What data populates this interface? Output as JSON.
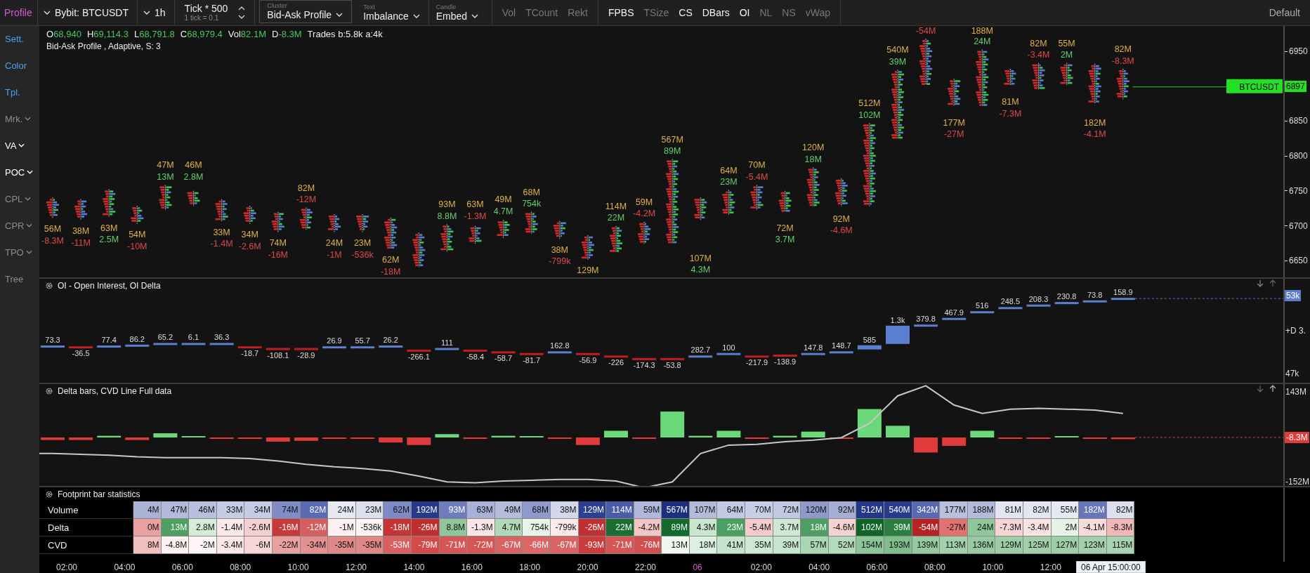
{
  "toolbar": {
    "profile": "Profile",
    "symbol": "Bybit: BTCUSDT",
    "timeframe": "1h",
    "tick": {
      "value": "Tick * 500",
      "hint": "1 tick = 0.1"
    },
    "selectors": [
      {
        "caption": "Cluster",
        "value": "Bid-Ask Profile",
        "selected": true
      },
      {
        "caption": "Text",
        "value": "Imbalance",
        "selected": false
      },
      {
        "caption": "Candle",
        "value": "Embed",
        "selected": false
      }
    ],
    "toggle_groups": [
      [
        {
          "label": "Vol",
          "on": false
        },
        {
          "label": "TCount",
          "on": false
        },
        {
          "label": "Rekt",
          "on": false
        }
      ],
      [
        {
          "label": "FPBS",
          "on": true
        },
        {
          "label": "TSize",
          "on": false
        },
        {
          "label": "CS",
          "on": true
        },
        {
          "label": "DBars",
          "on": true
        },
        {
          "label": "OI",
          "on": true
        },
        {
          "label": "NL",
          "on": false
        },
        {
          "label": "NS",
          "on": false
        },
        {
          "label": "vWap",
          "on": false
        }
      ]
    ],
    "layout": "Default"
  },
  "sidebar": [
    {
      "label": "Sett.",
      "kind": "link"
    },
    {
      "label": "Color",
      "kind": "link"
    },
    {
      "label": "Tpl.",
      "kind": "link"
    },
    {
      "label": "Mrk.",
      "kind": "menu",
      "enabled": false
    },
    {
      "label": "VA",
      "kind": "menu",
      "enabled": true
    },
    {
      "label": "POC",
      "kind": "menu",
      "enabled": true
    },
    {
      "label": "CPL",
      "kind": "menu",
      "enabled": false
    },
    {
      "label": "CPR",
      "kind": "menu",
      "enabled": false
    },
    {
      "label": "TPO",
      "kind": "menu",
      "enabled": false
    },
    {
      "label": "Tree",
      "kind": "item",
      "enabled": false
    }
  ],
  "main_chart": {
    "readouts": [
      {
        "label": "O",
        "value": "68,940"
      },
      {
        "label": "H",
        "value": "69,114.3"
      },
      {
        "label": "L",
        "value": "68,791.8"
      },
      {
        "label": "C",
        "value": "68,979.4"
      },
      {
        "label": "Vol",
        "value": "82.1M"
      },
      {
        "label": "D",
        "value": "-8.3M"
      }
    ],
    "trades": "Trades b:5.8k a:4k",
    "indicator": "Bid-Ask Profile , Adaptive, S: 3",
    "price_tag": "BTCUSDT",
    "price_axis": {
      "ticks": [
        "6950",
        "6850",
        "6800",
        "6750",
        "6700",
        "6650"
      ],
      "current": "6897"
    },
    "bars": [
      {
        "volume": "56M",
        "delta": "-8.3M",
        "delta_positive": false
      },
      {
        "volume": "38M",
        "delta": "-11M",
        "delta_positive": false
      },
      {
        "volume": "63M",
        "delta": "2.5M",
        "delta_positive": true
      },
      {
        "volume": "54M",
        "delta": "-10M",
        "delta_positive": false
      },
      {
        "volume": "47M",
        "delta": "13M",
        "delta_positive": true
      },
      {
        "volume": "46M",
        "delta": "2.8M",
        "delta_positive": true
      },
      {
        "volume": "33M",
        "delta": "-1.4M",
        "delta_positive": false
      },
      {
        "volume": "34M",
        "delta": "-2.6M",
        "delta_positive": false
      },
      {
        "volume": "74M",
        "delta": "-16M",
        "delta_positive": false
      },
      {
        "volume": "82M",
        "delta": "-12M",
        "delta_positive": false
      },
      {
        "volume": "24M",
        "delta": "-1M",
        "delta_positive": false
      },
      {
        "volume": "23M",
        "delta": "-536k",
        "delta_positive": false
      },
      {
        "volume": "62M",
        "delta": "-18M",
        "delta_positive": false
      },
      {
        "delta_positive": false
      },
      {
        "volume": "93M",
        "delta": "8.8M",
        "delta_positive": true
      },
      {
        "volume": "63M",
        "delta": "-1.3M",
        "delta_positive": false
      },
      {
        "volume": "49M",
        "delta": "4.7M",
        "delta_positive": true
      },
      {
        "volume": "68M",
        "delta": "754k",
        "delta_positive": true
      },
      {
        "volume": "38M",
        "delta": "-799k",
        "delta_positive": false
      },
      {
        "volume": "129M",
        "delta_positive": false
      },
      {
        "volume": "114M",
        "delta": "22M",
        "delta_positive": true
      },
      {
        "volume": "59M",
        "delta": "-4.2M",
        "delta_positive": false
      },
      {
        "volume": "567M",
        "delta": "89M",
        "delta_positive": true
      },
      {
        "volume": "107M",
        "delta": "4.3M",
        "delta_positive": true
      },
      {
        "volume": "64M",
        "delta": "23M",
        "delta_positive": true
      },
      {
        "volume": "70M",
        "delta": "-5.4M",
        "delta_positive": false
      },
      {
        "volume": "72M",
        "delta": "3.7M",
        "delta_positive": true
      },
      {
        "volume": "120M",
        "delta": "18M",
        "delta_positive": true
      },
      {
        "volume": "92M",
        "delta": "-4.6M",
        "delta_positive": false
      },
      {
        "volume": "512M",
        "delta": "102M",
        "delta_positive": true
      },
      {
        "volume": "540M",
        "delta": "39M",
        "delta_positive": true
      },
      {
        "delta": "-54M",
        "delta_positive": false
      },
      {
        "volume": "177M",
        "delta": "-27M",
        "delta_positive": false
      },
      {
        "volume": "188M",
        "delta": "24M",
        "delta_positive": true
      },
      {
        "volume": "81M",
        "delta": "-7.3M",
        "delta_positive": false
      },
      {
        "volume": "82M",
        "delta": "-3.4M",
        "delta_positive": false
      },
      {
        "volume": "55M",
        "delta": "2M",
        "delta_positive": true
      },
      {
        "volume": "182M",
        "delta": "-4.1M",
        "delta_positive": false
      },
      {
        "volume": "82M",
        "delta": "-8.3M",
        "delta_positive": false
      }
    ]
  },
  "oi": {
    "title": "OI - Open Interest, OI Delta",
    "axis": {
      "current": "53k",
      "middle": "+D 3.",
      "bottom": "47k"
    },
    "items": [
      {
        "value": "73.3",
        "positive": true
      },
      {
        "value": "-36.5",
        "positive": false
      },
      {
        "value": "77.4",
        "positive": true
      },
      {
        "value": "86.2",
        "positive": true
      },
      {
        "value": "65.2",
        "positive": true
      },
      {
        "value": "6.1",
        "positive": true
      },
      {
        "value": "36.3",
        "positive": true
      },
      {
        "value": "-18.7",
        "positive": false
      },
      {
        "value": "-108.1",
        "positive": false
      },
      {
        "value": "-28.9",
        "positive": false
      },
      {
        "value": "26.9",
        "positive": true
      },
      {
        "value": "55.7",
        "positive": true
      },
      {
        "value": "26.2",
        "positive": true
      },
      {
        "value": "-266.1",
        "positive": false
      },
      {
        "value": "111",
        "positive": true
      },
      {
        "value": "-58.4",
        "positive": false
      },
      {
        "value": "-58.7",
        "positive": false
      },
      {
        "value": "-81.7",
        "positive": false
      },
      {
        "value": "162.8",
        "positive": true
      },
      {
        "value": "-56.9",
        "positive": false
      },
      {
        "value": "-226",
        "positive": false
      },
      {
        "value": "-174.3",
        "positive": false
      },
      {
        "value": "-53.8",
        "positive": false
      },
      {
        "value": "282.7",
        "positive": true
      },
      {
        "value": "100",
        "positive": true
      },
      {
        "value": "-217.9",
        "positive": false
      },
      {
        "value": "-138.9",
        "positive": false
      },
      {
        "value": "147.8",
        "positive": true
      },
      {
        "value": "148.7",
        "positive": true
      },
      {
        "value": "585",
        "positive": true
      },
      {
        "value": "1.3k",
        "positive": true
      },
      {
        "value": "379.8",
        "positive": true
      },
      {
        "value": "467.9",
        "positive": true
      },
      {
        "value": "516",
        "positive": true
      },
      {
        "value": "248.5",
        "positive": true
      },
      {
        "value": "208.3",
        "positive": true
      },
      {
        "value": "230.8",
        "positive": true
      },
      {
        "value": "73.8",
        "positive": true
      },
      {
        "value": "158.9",
        "positive": true
      }
    ]
  },
  "delta_panel": {
    "title": "Delta bars, CVD Line Full data",
    "axis": {
      "top": "143M",
      "current": "-8.3M",
      "bottom": "-152M"
    }
  },
  "stats": {
    "title": "Footprint bar statistics",
    "rows": [
      {
        "label": "Volume",
        "cells": [
          {
            "text": "4M",
            "color": "#aab3d6"
          },
          {
            "text": "47M",
            "color": "#b3bbdc"
          },
          {
            "text": "46M",
            "color": "#b8c0de"
          },
          {
            "text": "33M",
            "color": "#c6cce4"
          },
          {
            "text": "34M",
            "color": "#c6cce4"
          },
          {
            "text": "74M",
            "color": "#7f8cc5"
          },
          {
            "text": "82M",
            "color": "#5a6ab3"
          },
          {
            "text": "24M",
            "color": "#e6e8f2"
          },
          {
            "text": "23M",
            "color": "#dcdfee"
          },
          {
            "text": "62M",
            "color": "#7d8ac4"
          },
          {
            "text": "192M",
            "color": "#273a8a"
          },
          {
            "text": "93M",
            "color": "#6f7dbc"
          },
          {
            "text": "63M",
            "color": "#a8b1d6"
          },
          {
            "text": "49M",
            "color": "#b4bcdb"
          },
          {
            "text": "68M",
            "color": "#8e9acb"
          },
          {
            "text": "38M",
            "color": "#d3d7ea"
          },
          {
            "text": "129M",
            "color": "#2d3f8f"
          },
          {
            "text": "114M",
            "color": "#4b5ca9"
          },
          {
            "text": "59M",
            "color": "#b0b8da"
          },
          {
            "text": "567M",
            "color": "#1d2f7e"
          },
          {
            "text": "107M",
            "color": "#b3bbdb"
          },
          {
            "text": "64M",
            "color": "#c2c9e2"
          },
          {
            "text": "70M",
            "color": "#c8cee5"
          },
          {
            "text": "72M",
            "color": "#c1c8e2"
          },
          {
            "text": "120M",
            "color": "#8f9acb"
          },
          {
            "text": "92M",
            "color": "#a4aed4"
          },
          {
            "text": "512M",
            "color": "#25378a"
          },
          {
            "text": "540M",
            "color": "#283a8b"
          },
          {
            "text": "342M",
            "color": "#5868b2"
          },
          {
            "text": "177M",
            "color": "#b8c0de"
          },
          {
            "text": "188M",
            "color": "#b3bbdb"
          },
          {
            "text": "81M",
            "color": "#e3e6f1"
          },
          {
            "text": "82M",
            "color": "#e4e7f1"
          },
          {
            "text": "55M",
            "color": "#e6e8f2"
          },
          {
            "text": "182M",
            "color": "#6776b9"
          },
          {
            "text": "82M",
            "color": "#dde0ef"
          }
        ]
      },
      {
        "label": "Delta",
        "cells": [
          {
            "text": "0M",
            "color": "#e9a0a0"
          },
          {
            "text": "13M",
            "color": "#4f9e62"
          },
          {
            "text": "2.8M",
            "color": "#d5ecd9"
          },
          {
            "text": "-1.4M",
            "color": "#fbe9e9"
          },
          {
            "text": "-2.6M",
            "color": "#f5d0d0"
          },
          {
            "text": "-16M",
            "color": "#c83a3a"
          },
          {
            "text": "-12M",
            "color": "#d55e5e"
          },
          {
            "text": "-1M",
            "color": "#fdf0f0"
          },
          {
            "text": "-536k",
            "color": "#fdf3f3"
          },
          {
            "text": "-18M",
            "color": "#c43535"
          },
          {
            "text": "-26M",
            "color": "#bf2e2e"
          },
          {
            "text": "8.8M",
            "color": "#8fc79b"
          },
          {
            "text": "-1.3M",
            "color": "#fae6e6"
          },
          {
            "text": "4.7M",
            "color": "#aed8b7"
          },
          {
            "text": "754k",
            "color": "#e8f4ea"
          },
          {
            "text": "-799k",
            "color": "#fbeaea"
          },
          {
            "text": "-26M",
            "color": "#c03030"
          },
          {
            "text": "22M",
            "color": "#1b6e33"
          },
          {
            "text": "-4.2M",
            "color": "#f3c6c6"
          },
          {
            "text": "89M",
            "color": "#126a2c"
          },
          {
            "text": "4.3M",
            "color": "#c9e6cf"
          },
          {
            "text": "23M",
            "color": "#4aa060"
          },
          {
            "text": "-5.4M",
            "color": "#f4caca"
          },
          {
            "text": "3.7M",
            "color": "#cfe8d4"
          },
          {
            "text": "18M",
            "color": "#4d9e62"
          },
          {
            "text": "-4.6M",
            "color": "#f6d3d3"
          },
          {
            "text": "102M",
            "color": "#0f6428"
          },
          {
            "text": "39M",
            "color": "#2a7f40"
          },
          {
            "text": "-54M",
            "color": "#b52424"
          },
          {
            "text": "-27M",
            "color": "#e27272"
          },
          {
            "text": "24M",
            "color": "#8ec79a"
          },
          {
            "text": "-7.3M",
            "color": "#f7d5d5"
          },
          {
            "text": "-3.4M",
            "color": "#fae3e3"
          },
          {
            "text": "2M",
            "color": "#e6f2e8"
          },
          {
            "text": "-4.1M",
            "color": "#f8dbdb"
          },
          {
            "text": "-8.3M",
            "color": "#f1b8b8"
          }
        ]
      },
      {
        "label": "CVD",
        "cells": [
          {
            "text": "8M",
            "color": "#f0c0c0"
          },
          {
            "text": "-4.8M",
            "color": "#fdf1f1"
          },
          {
            "text": "-2M",
            "color": "#fef6f6"
          },
          {
            "text": "-3.4M",
            "color": "#fbe7e7"
          },
          {
            "text": "-6M",
            "color": "#f6d6d6"
          },
          {
            "text": "-22M",
            "color": "#e8a0a0"
          },
          {
            "text": "-34M",
            "color": "#e39090"
          },
          {
            "text": "-35M",
            "color": "#e08888"
          },
          {
            "text": "-35M",
            "color": "#e08888"
          },
          {
            "text": "-53M",
            "color": "#d96060"
          },
          {
            "text": "-79M",
            "color": "#d24a4a"
          },
          {
            "text": "-71M",
            "color": "#d65656"
          },
          {
            "text": "-72M",
            "color": "#d55555"
          },
          {
            "text": "-67M",
            "color": "#d96262"
          },
          {
            "text": "-66M",
            "color": "#da6666"
          },
          {
            "text": "-67M",
            "color": "#d96262"
          },
          {
            "text": "-93M",
            "color": "#cc3b3b"
          },
          {
            "text": "-71M",
            "color": "#d65656"
          },
          {
            "text": "-76M",
            "color": "#d24f4f"
          },
          {
            "text": "13M",
            "color": "#f0f8f2"
          },
          {
            "text": "18M",
            "color": "#dcefe1"
          },
          {
            "text": "41M",
            "color": "#c5e4cc"
          },
          {
            "text": "35M",
            "color": "#cde8d3"
          },
          {
            "text": "39M",
            "color": "#c8e6ce"
          },
          {
            "text": "57M",
            "color": "#a9d6b3"
          },
          {
            "text": "52M",
            "color": "#b2dabb"
          },
          {
            "text": "154M",
            "color": "#8cc598"
          },
          {
            "text": "193M",
            "color": "#7fbe8c"
          },
          {
            "text": "139M",
            "color": "#95c9a0"
          },
          {
            "text": "113M",
            "color": "#a2d0ac"
          },
          {
            "text": "136M",
            "color": "#97caa2"
          },
          {
            "text": "129M",
            "color": "#9ccda7"
          },
          {
            "text": "125M",
            "color": "#a0cfaa"
          },
          {
            "text": "127M",
            "color": "#9ecea8"
          },
          {
            "text": "123M",
            "color": "#a2d0ac"
          },
          {
            "text": "115M",
            "color": "#a7d3b1"
          }
        ]
      }
    ]
  },
  "time_axis": {
    "labels": [
      {
        "text": "02:00",
        "kind": "time"
      },
      {
        "text": "04:00",
        "kind": "time"
      },
      {
        "text": "06:00",
        "kind": "time"
      },
      {
        "text": "08:00",
        "kind": "time"
      },
      {
        "text": "10:00",
        "kind": "time"
      },
      {
        "text": "12:00",
        "kind": "time"
      },
      {
        "text": "14:00",
        "kind": "time"
      },
      {
        "text": "16:00",
        "kind": "time"
      },
      {
        "text": "18:00",
        "kind": "time"
      },
      {
        "text": "20:00",
        "kind": "time"
      },
      {
        "text": "22:00",
        "kind": "time"
      },
      {
        "text": "06",
        "kind": "day"
      },
      {
        "text": "02:00",
        "kind": "time"
      },
      {
        "text": "04:00",
        "kind": "time"
      },
      {
        "text": "06:00",
        "kind": "time"
      },
      {
        "text": "08:00",
        "kind": "time"
      },
      {
        "text": "10:00",
        "kind": "time"
      },
      {
        "text": "12:00",
        "kind": "time"
      }
    ],
    "cursor_label": "06 Apr 15:00:00"
  }
}
